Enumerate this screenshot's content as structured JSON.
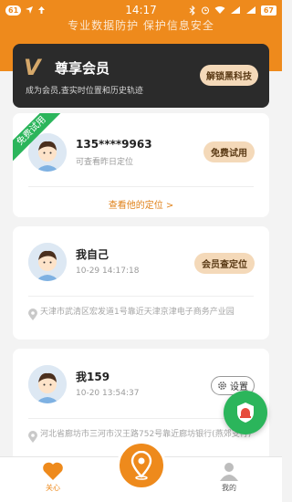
{
  "status_bar": {
    "notif_count": "61",
    "time": "14:17",
    "battery": "67"
  },
  "header": {
    "slogan": "专业数据防护 保护信息安全"
  },
  "vip": {
    "logo": "V",
    "title": "尊享会员",
    "subtitle": "成为会员,查实时位置和历史轨迹",
    "button": "解锁黑科技"
  },
  "contacts": [
    {
      "ribbon": "免费试用",
      "name": "135****9963",
      "meta": "可查看昨日定位",
      "button": "免费试用",
      "link": "查看他的定位 >"
    },
    {
      "name": "我自己",
      "meta": "10-29 14:17:18",
      "button": "会员查定位",
      "address": "天津市武清区宏发道1号靠近天津京津电子商务产业园"
    },
    {
      "name": "我159",
      "meta": "10-20 13:54:37",
      "button": "设置",
      "address": "河北省廊坊市三河市汉王路752号靠近廊坊银行(燕郊支行)"
    }
  ],
  "tabbar": {
    "care": "关心",
    "mine": "我的"
  },
  "colors": {
    "accent": "#ee8a1c",
    "green": "#2bb55b",
    "dark_card": "#2b2b2b",
    "gold_btn": "#f4d9b9"
  }
}
